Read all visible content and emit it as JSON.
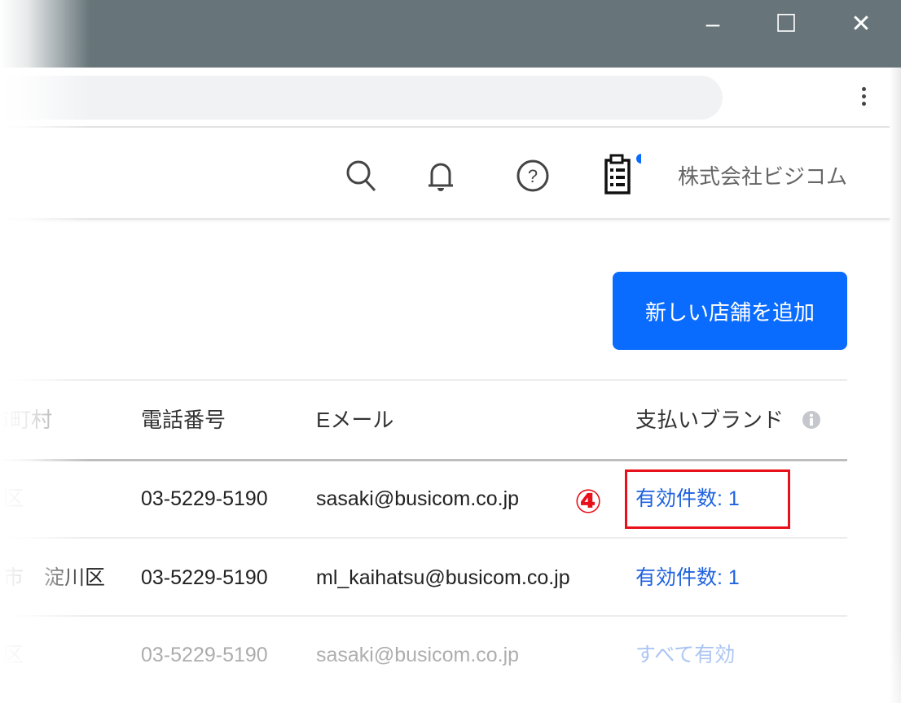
{
  "window": {
    "minimize": "–",
    "maximize": "☐",
    "close": "✕"
  },
  "header": {
    "company": "株式会社ビジコム",
    "icons": [
      "search-icon",
      "bell-icon",
      "help-icon",
      "clipboard-list-icon"
    ],
    "notification_dot_color": "#0a6cff"
  },
  "main": {
    "add_store_button": "新しい店舗を追加",
    "accent_color": "#0a6cff"
  },
  "table": {
    "columns": [
      "市町村",
      "電話番号",
      "Eメール",
      "支払いブランド"
    ],
    "rows": [
      {
        "city": "区",
        "phone": "03-5229-5190",
        "email": "sasaki@busicom.co.jp",
        "brand": "有効件数: 1"
      },
      {
        "city": "市　淀川区",
        "phone": "03-5229-5190",
        "email": "ml_kaihatsu@busicom.co.jp",
        "brand": "有効件数: 1"
      },
      {
        "city": "区",
        "phone": "03-5229-5190",
        "email": "sasaki@busicom.co.jp",
        "brand": "すべて有効"
      }
    ]
  },
  "annotation": {
    "marker": "④",
    "color": "#e8101a"
  }
}
